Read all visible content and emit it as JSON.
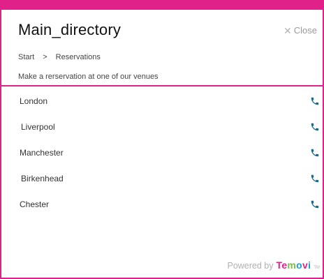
{
  "header": {
    "title": "Main_directory",
    "close_label": "Close",
    "close_icon": "x-icon"
  },
  "breadcrumb": {
    "items": [
      "Start",
      "Reservations"
    ],
    "separator": ">"
  },
  "subtitle": "Make a rerservation at one of our venues",
  "venues": [
    {
      "label": "London",
      "icon": "phone-icon"
    },
    {
      "label": "Liverpool",
      "icon": "phone-icon"
    },
    {
      "label": "Manchester",
      "icon": "phone-icon"
    },
    {
      "label": "Birkenhead",
      "icon": "phone-icon"
    },
    {
      "label": "Chester",
      "icon": "phone-icon"
    }
  ],
  "footer": {
    "powered_by": "Powered by",
    "brand": "Temovi",
    "trademark": "TM"
  },
  "colors": {
    "accent": "#e0218a",
    "phone_icon": "#1a6a86",
    "brand_green": "#7ac143",
    "brand_blue": "#1f9ad6"
  }
}
